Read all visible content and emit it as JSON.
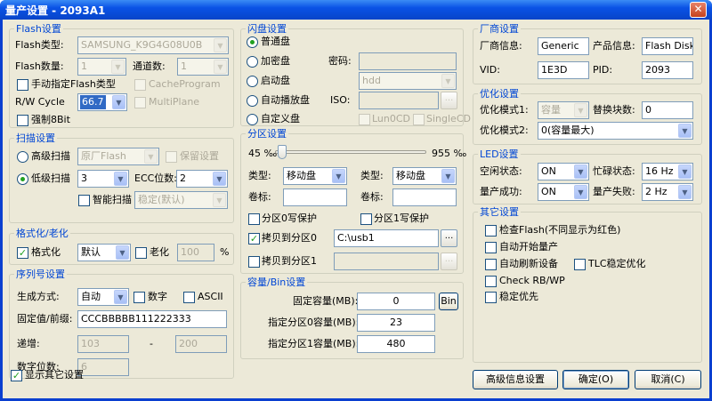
{
  "title": "量产设置 - 2093A1",
  "flash": {
    "title": "Flash设置",
    "type_label": "Flash类型:",
    "type_value": "SAMSUNG_K9G4G08U0B",
    "count_label": "Flash数量:",
    "count_value": "1",
    "channel_label": "通道数:",
    "channel_value": "1",
    "manual_label": "手动指定Flash类型",
    "cache_label": "CacheProgram",
    "rw_label": "R/W Cycle",
    "rw_value": "66.7",
    "multiplane_label": "MultiPlane",
    "force8_label": "强制8Bit"
  },
  "scan": {
    "title": "扫描设置",
    "advanced_label": "高级扫描",
    "advanced_value": "原厂Flash",
    "keep_label": "保留设置",
    "low_label": "低级扫描",
    "low_value": "3",
    "ecc_label": "ECC位数:",
    "ecc_value": "2",
    "smart_label": "智能扫描",
    "smart_value": "稳定(默认)"
  },
  "format": {
    "title": "格式化/老化",
    "fmt_label": "格式化",
    "fmt_value": "默认",
    "aging_label": "老化",
    "aging_value": "100",
    "pct": "%"
  },
  "serial": {
    "title": "序列号设置",
    "gen_label": "生成方式:",
    "gen_value": "自动",
    "digit_label": "数字",
    "ascii_label": "ASCII",
    "fixed_label": "固定值/前缀:",
    "fixed_value": "CCCBBBBB111222333",
    "inc_label": "递增:",
    "inc_from": "103",
    "dash": "-",
    "inc_to": "200",
    "digits_label": "数字位数:",
    "digits_value": "6"
  },
  "show_other_label": "显示其它设置",
  "disk": {
    "title": "闪盘设置",
    "normal": "普通盘",
    "encrypt": "加密盘",
    "pwd_label": "密码:",
    "boot": "启动盘",
    "boot_value": "hdd",
    "autoplay": "自动播放盘",
    "iso_label": "ISO:",
    "browse": "...",
    "custom": "自定义盘",
    "lun0": "Lun0CD",
    "single": "SingleCD"
  },
  "part": {
    "title": "分区设置",
    "left_pct": "45 ‰",
    "right_pct": "955 ‰",
    "slider_fraction": 0.045,
    "type_label": "类型:",
    "type_value": "移动盘",
    "type2_value": "移动盘",
    "vol_label": "卷标:",
    "wp0": "分区0写保护",
    "wp1": "分区1写保护",
    "copy0": "拷贝到分区0",
    "copy0_value": "C:\\usb1",
    "copy1": "拷贝到分区1",
    "browse": "..."
  },
  "cap": {
    "title": "容量/Bin设置",
    "fixed_label": "固定容量(MB):",
    "fixed_value": "0",
    "bin": "Bin",
    "p0_label": "指定分区0容量(MB):",
    "p0_value": "23",
    "p1_label": "指定分区1容量(MB):",
    "p1_value": "480"
  },
  "vendor": {
    "title": "厂商设置",
    "info_label": "厂商信息:",
    "info_value": "Generic",
    "prod_label": "产品信息:",
    "prod_value": "Flash Disk",
    "vid_label": "VID:",
    "vid_value": "1E3D",
    "pid_label": "PID:",
    "pid_value": "2093"
  },
  "opt": {
    "title": "优化设置",
    "mode1_label": "优化模式1:",
    "mode1_value": "容量",
    "replace_label": "替换块数:",
    "replace_value": "0",
    "mode2_label": "优化模式2:",
    "mode2_value": "0(容量最大)"
  },
  "led": {
    "title": "LED设置",
    "idle_label": "空闲状态:",
    "idle_value": "ON",
    "busy_label": "忙碌状态:",
    "busy_value": "16 Hz",
    "ok_label": "量产成功:",
    "ok_value": "ON",
    "fail_label": "量产失败:",
    "fail_value": "2 Hz"
  },
  "other": {
    "title": "其它设置",
    "check_flash": "检查Flash(不同显示为红色)",
    "auto_start": "自动开始量产",
    "auto_refresh": "自动刷新设备",
    "tlc": "TLC稳定优化",
    "check_rbwp": "Check RB/WP",
    "stable": "稳定优先"
  },
  "buttons": {
    "advanced": "高级信息设置",
    "ok": "确定(O)",
    "cancel": "取消(C)"
  },
  "close_glyph": "✕",
  "check_glyph": "✓"
}
